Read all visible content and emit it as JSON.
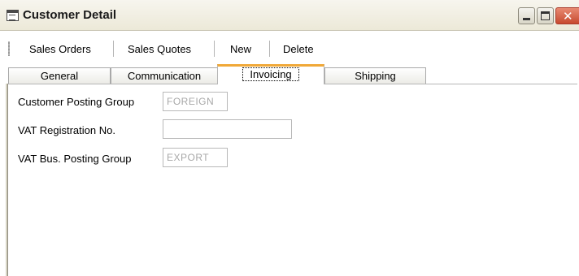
{
  "window": {
    "title": "Customer Detail"
  },
  "toolbar": {
    "items": [
      "Sales Orders",
      "Sales Quotes",
      "New",
      "Delete"
    ]
  },
  "tabs": [
    {
      "label": "General",
      "active": false
    },
    {
      "label": "Communication",
      "active": false
    },
    {
      "label": "Invoicing",
      "active": true
    },
    {
      "label": "Shipping",
      "active": false
    }
  ],
  "form": {
    "customer_posting_group": {
      "label": "Customer Posting Group",
      "value": "FOREIGN"
    },
    "vat_registration_no": {
      "label": "VAT Registration No.",
      "value": ""
    },
    "vat_bus_posting_group": {
      "label": "VAT Bus. Posting Group",
      "value": "EXPORT"
    }
  },
  "colors": {
    "active_tab_accent": "#f0a838",
    "close_button": "#c74a2f",
    "disabled_text": "#a8a8a8"
  },
  "icons": {
    "window_icon": "form-window-icon",
    "minimize": "minimize-icon",
    "maximize": "maximize-icon",
    "close": "close-icon"
  }
}
